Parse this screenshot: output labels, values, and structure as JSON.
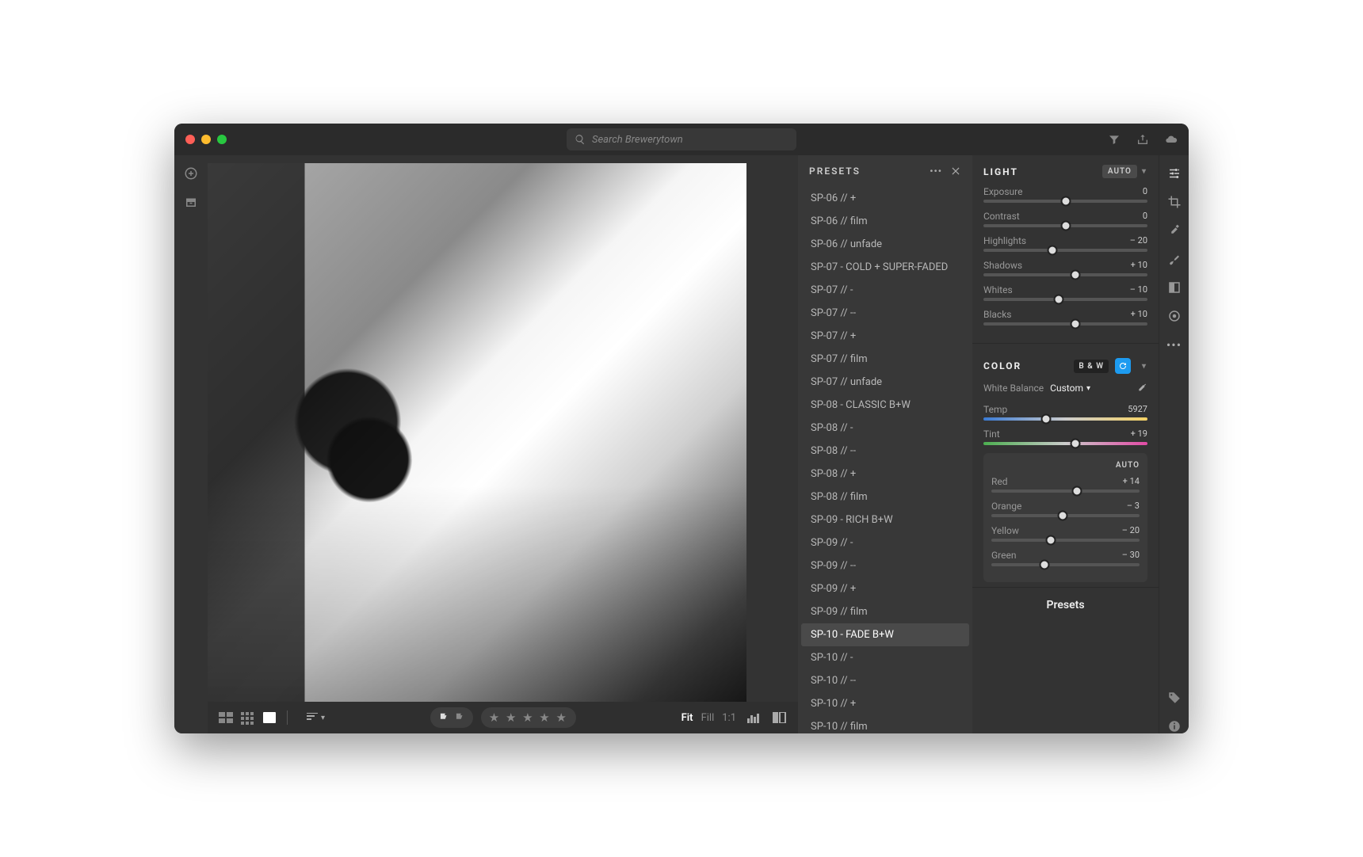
{
  "search": {
    "placeholder": "Search Brewerytown"
  },
  "presets": {
    "title": "PRESETS",
    "selectedIndex": 19,
    "items": [
      "SP-06 // +",
      "SP-06 // film",
      "SP-06 // unfade",
      "SP-07 - COLD + SUPER-FADED",
      "SP-07 // -",
      "SP-07 // --",
      "SP-07 // +",
      "SP-07 // film",
      "SP-07 // unfade",
      "SP-08 - CLASSIC B+W",
      "SP-08 // -",
      "SP-08 // --",
      "SP-08 // +",
      "SP-08 // film",
      "SP-09 - RICH B+W",
      "SP-09 // -",
      "SP-09 // --",
      "SP-09 // +",
      "SP-09 // film",
      "SP-10 - FADE B+W",
      "SP-10 // -",
      "SP-10 // --",
      "SP-10 // +",
      "SP-10 // film"
    ]
  },
  "light": {
    "title": "LIGHT",
    "auto": "AUTO",
    "sliders": [
      {
        "label": "Exposure",
        "value": "0",
        "pos": 50
      },
      {
        "label": "Contrast",
        "value": "0",
        "pos": 50
      },
      {
        "label": "Highlights",
        "value": "– 20",
        "pos": 42
      },
      {
        "label": "Shadows",
        "value": "+ 10",
        "pos": 56
      },
      {
        "label": "Whites",
        "value": "– 10",
        "pos": 46
      },
      {
        "label": "Blacks",
        "value": "+ 10",
        "pos": 56
      }
    ]
  },
  "color": {
    "title": "COLOR",
    "bw": "B & W",
    "wb_label": "White Balance",
    "wb_value": "Custom",
    "temp": {
      "label": "Temp",
      "value": "5927",
      "pos": 38
    },
    "tint": {
      "label": "Tint",
      "value": "+ 19",
      "pos": 56
    },
    "mix_auto": "AUTO",
    "mix": [
      {
        "label": "Red",
        "value": "+ 14",
        "pos": 58
      },
      {
        "label": "Orange",
        "value": "– 3",
        "pos": 48
      },
      {
        "label": "Yellow",
        "value": "– 20",
        "pos": 40
      },
      {
        "label": "Green",
        "value": "– 30",
        "pos": 36
      }
    ]
  },
  "footer": {
    "fit": "Fit",
    "fill": "Fill",
    "one": "1:1",
    "presets_button": "Presets"
  }
}
